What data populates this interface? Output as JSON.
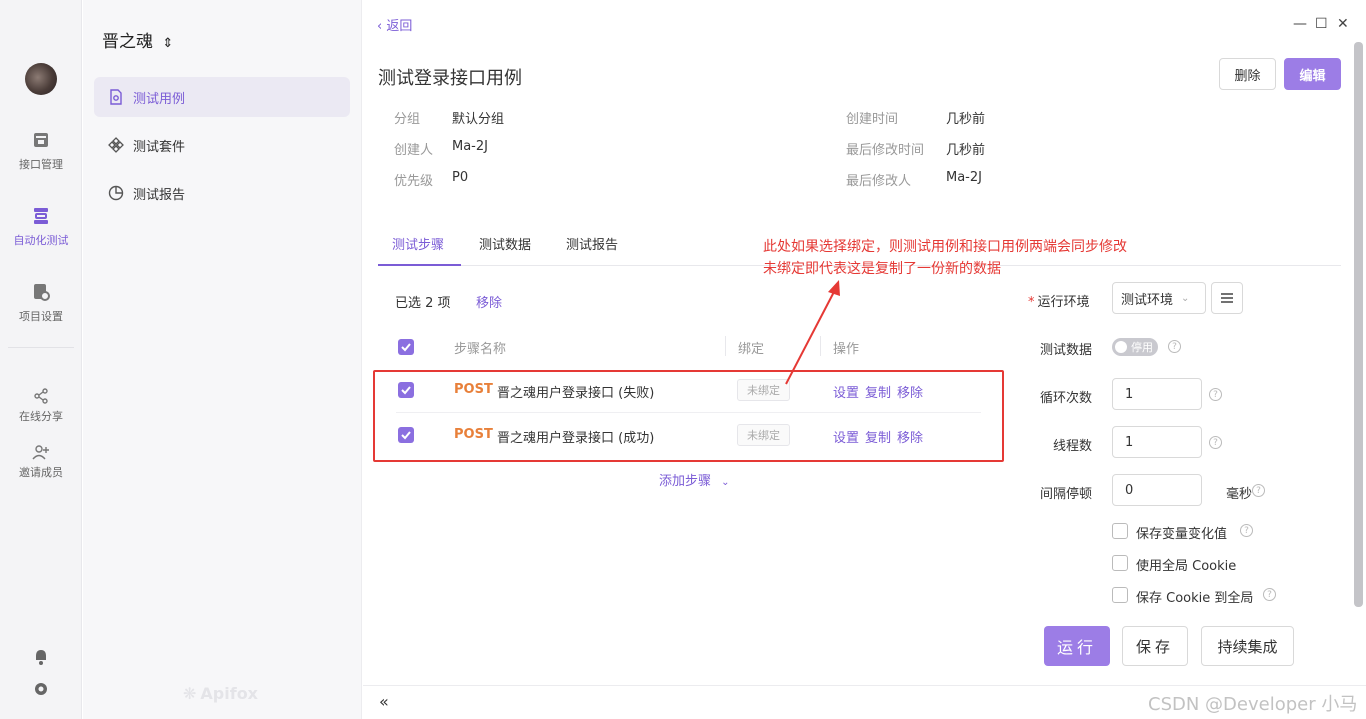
{
  "rail": {
    "items": [
      {
        "label": "接口管理"
      },
      {
        "label": "自动化测试"
      },
      {
        "label": "项目设置"
      },
      {
        "label": "在线分享"
      },
      {
        "label": "邀请成员"
      }
    ]
  },
  "sidebar": {
    "project": "晋之魂",
    "items": [
      {
        "label": "测试用例"
      },
      {
        "label": "测试套件"
      },
      {
        "label": "测试报告"
      }
    ],
    "brand": "Apifox"
  },
  "main": {
    "back": "返回",
    "title": "测试登录接口用例",
    "delete_label": "删除",
    "edit_label": "编辑",
    "meta": {
      "group_label": "分组",
      "group_value": "默认分组",
      "creator_label": "创建人",
      "creator_value": "Ma-2J",
      "priority_label": "优先级",
      "priority_value": "P0",
      "created_label": "创建时间",
      "created_value": "几秒前",
      "modified_label": "最后修改时间",
      "modified_value": "几秒前",
      "modifier_label": "最后修改人",
      "modifier_value": "Ma-2J"
    },
    "tabs": [
      {
        "label": "测试步骤"
      },
      {
        "label": "测试数据"
      },
      {
        "label": "测试报告"
      }
    ],
    "selected": "已选 2 项",
    "remove": "移除",
    "columns": {
      "name": "步骤名称",
      "bind": "绑定",
      "ops": "操作"
    },
    "steps": [
      {
        "method": "POST",
        "name": "晋之魂用户登录接口 (失败)",
        "bind": "未绑定",
        "set": "设置",
        "copy": "复制",
        "remove": "移除"
      },
      {
        "method": "POST",
        "name": "晋之魂用户登录接口 (成功)",
        "bind": "未绑定",
        "set": "设置",
        "copy": "复制",
        "remove": "移除"
      }
    ],
    "add_step": "添加步骤",
    "annotation_line1": "此处如果选择绑定，则测试用例和接口用例两端会同步修改",
    "annotation_line2": "未绑定即代表这是复制了一份新的数据"
  },
  "config": {
    "env_label": "运行环境",
    "env_value": "测试环境",
    "data_label": "测试数据",
    "data_toggle": "停用",
    "loop_label": "循环次数",
    "loop_value": "1",
    "thread_label": "线程数",
    "thread_value": "1",
    "interval_label": "间隔停顿",
    "interval_value": "0",
    "interval_unit": "毫秒",
    "opt1": "保存变量变化值",
    "opt2": "使用全局 Cookie",
    "opt3": "保存 Cookie 到全局",
    "run": "运行",
    "save": "保存",
    "ci": "持续集成"
  },
  "watermark": "CSDN @Developer 小马",
  "colors": {
    "accent": "#9c7de6",
    "post": "#e8803a",
    "annotation": "#e53935"
  }
}
